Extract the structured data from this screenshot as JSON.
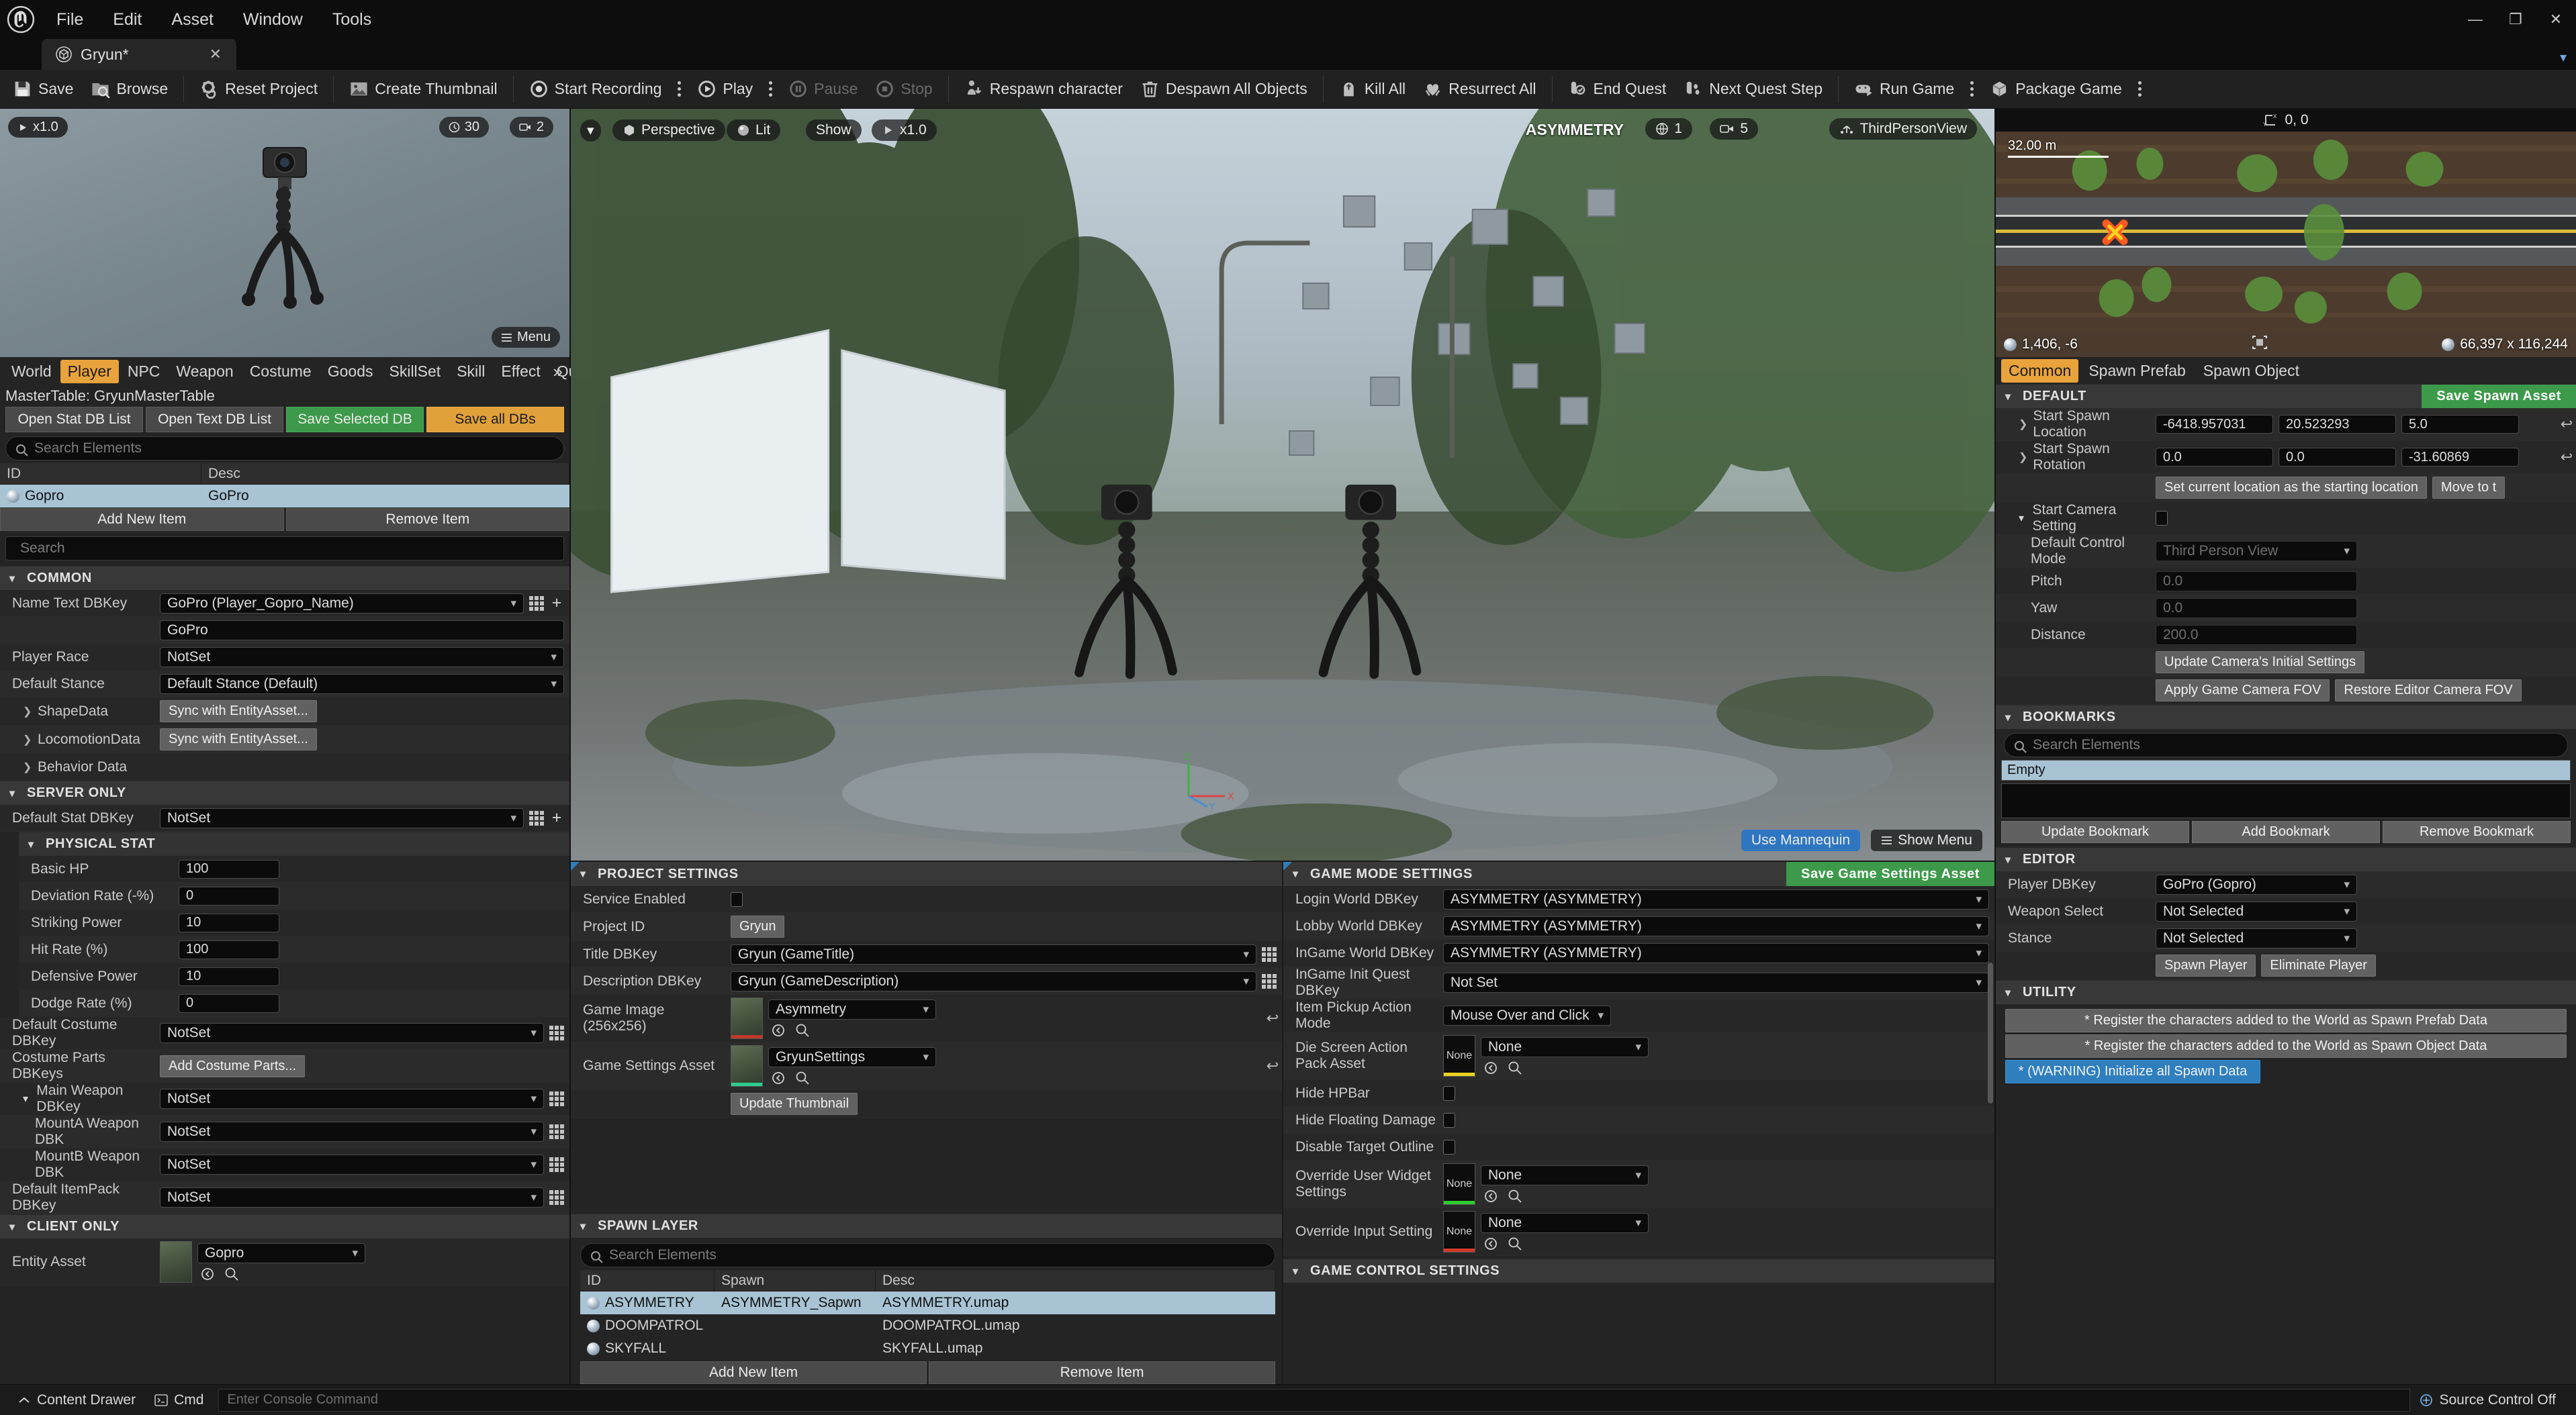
{
  "titlebar": {
    "menus": [
      "File",
      "Edit",
      "Asset",
      "Window",
      "Tools"
    ],
    "window_controls": {
      "minimize": "—",
      "maximize": "❐",
      "close": "✕"
    }
  },
  "tabstrip": {
    "tab_label": "Gryun*",
    "tab_close": "✕"
  },
  "toolbar": {
    "groups": [
      {
        "items": [
          {
            "name": "save-button",
            "label": "Save",
            "icon": "save-icon"
          },
          {
            "name": "browse-button",
            "label": "Browse",
            "icon": "browse-icon"
          }
        ]
      },
      {
        "items": [
          {
            "name": "reset-project-button",
            "label": "Reset Project",
            "icon": "gear-reset-icon"
          }
        ]
      },
      {
        "items": [
          {
            "name": "create-thumbnail-button",
            "label": "Create Thumbnail",
            "icon": "image-icon"
          }
        ]
      },
      {
        "items": [
          {
            "name": "start-recording-button",
            "label": "Start Recording",
            "icon": "record-icon",
            "kebab": true
          },
          {
            "name": "play-button",
            "label": "Play",
            "icon": "play-icon",
            "kebab": true
          },
          {
            "name": "pause-button",
            "label": "Pause",
            "icon": "pause-icon",
            "dim": true
          },
          {
            "name": "stop-button",
            "label": "Stop",
            "icon": "stop-icon",
            "dim": true
          }
        ]
      },
      {
        "items": [
          {
            "name": "respawn-character-button",
            "label": "Respawn character",
            "icon": "person-down-icon"
          },
          {
            "name": "despawn-all-objects-button",
            "label": "Despawn All Objects",
            "icon": "trash-icon"
          }
        ]
      },
      {
        "items": [
          {
            "name": "kill-all-button",
            "label": "Kill All",
            "icon": "tombstone-icon"
          },
          {
            "name": "resurrect-all-button",
            "label": "Resurrect All",
            "icon": "wings-icon"
          }
        ]
      },
      {
        "items": [
          {
            "name": "end-quest-button",
            "label": "End Quest",
            "icon": "scroll-check-icon"
          },
          {
            "name": "next-quest-step-button",
            "label": "Next Quest Step",
            "icon": "scroll-steps-icon"
          }
        ]
      },
      {
        "items": [
          {
            "name": "run-game-button",
            "label": "Run Game",
            "icon": "gamepad-icon",
            "kebab": true
          },
          {
            "name": "package-game-button",
            "label": "Package Game",
            "icon": "box-icon",
            "kebab": true
          }
        ]
      }
    ]
  },
  "preview": {
    "scale_badge": "x1.0",
    "fps_badge": "30",
    "cam_badge": "2",
    "menu_badge": "Menu"
  },
  "db": {
    "tabs": [
      "World",
      "Player",
      "NPC",
      "Weapon",
      "Costume",
      "Goods",
      "SkillSet",
      "Skill",
      "Effect",
      "Quest"
    ],
    "active_tab": "Player",
    "mastertable_label": "MasterTable:",
    "mastertable_value": "GryunMasterTable",
    "buttons": [
      {
        "label": "Open Stat DB List",
        "style": "grey"
      },
      {
        "label": "Open Text DB List",
        "style": "grey"
      },
      {
        "label": "Save Selected DB",
        "style": "green"
      },
      {
        "label": "Save all DBs",
        "style": "orange"
      }
    ],
    "search_placeholder": "Search Elements",
    "columns": [
      "ID",
      "Desc"
    ],
    "rows": [
      {
        "id": "Gopro",
        "desc": "GoPro",
        "selected": true
      }
    ],
    "add_label": "Add New Item",
    "remove_label": "Remove Item"
  },
  "details": {
    "search_placeholder": "Search",
    "sections": [
      {
        "title": "COMMON",
        "rows": [
          {
            "label": "Name Text DBKey",
            "type": "combo",
            "value": "GoPro (Player_Gopro_Name)",
            "grid": true,
            "plus": true
          },
          {
            "label": "",
            "type": "text",
            "value": "GoPro"
          },
          {
            "label": "Player Race",
            "type": "combo",
            "value": "NotSet"
          },
          {
            "label": "Default Stance",
            "type": "combo",
            "value": "Default Stance (Default)"
          },
          {
            "label": "ShapeData",
            "type": "button",
            "value": "Sync with EntityAsset...",
            "expand": true
          },
          {
            "label": "LocomotionData",
            "type": "button",
            "value": "Sync with EntityAsset...",
            "expand": true
          },
          {
            "label": "Behavior Data",
            "type": "empty",
            "value": "",
            "expand": true
          }
        ]
      },
      {
        "title": "SERVER ONLY",
        "rows": [
          {
            "label": "Default Stat DBKey",
            "type": "combo",
            "value": "NotSet",
            "grid": true,
            "plus": true
          }
        ]
      },
      {
        "title": "PHYSICAL STAT",
        "sub": true,
        "rows": [
          {
            "label": "Basic HP",
            "type": "num",
            "value": "100"
          },
          {
            "label": "Deviation Rate (-%)",
            "type": "num",
            "value": "0"
          },
          {
            "label": "Striking Power",
            "type": "num",
            "value": "10"
          },
          {
            "label": "Hit Rate (%)",
            "type": "num",
            "value": "100"
          },
          {
            "label": "Defensive Power",
            "type": "num",
            "value": "10"
          },
          {
            "label": "Dodge Rate (%)",
            "type": "num",
            "value": "0"
          }
        ]
      },
      {
        "title": "",
        "rows": [
          {
            "label": "Default Costume DBKey",
            "type": "combo",
            "value": "NotSet",
            "grid": true
          },
          {
            "label": "Costume Parts DBKeys",
            "type": "button",
            "value": "Add Costume Parts..."
          },
          {
            "label": "Main Weapon DBKey",
            "type": "combo",
            "value": "NotSet",
            "grid": true,
            "expanded": true
          },
          {
            "label": "MountA Weapon DBK",
            "type": "combo",
            "value": "NotSet",
            "grid": true,
            "indent": 2
          },
          {
            "label": "MountB Weapon DBK",
            "type": "combo",
            "value": "NotSet",
            "grid": true,
            "indent": 2
          },
          {
            "label": "Default ItemPack DBKey",
            "type": "combo",
            "value": "NotSet",
            "grid": true
          }
        ]
      },
      {
        "title": "CLIENT ONLY",
        "rows": [
          {
            "label": "Entity Asset",
            "type": "asset",
            "value": "Gopro"
          }
        ]
      }
    ]
  },
  "viewport": {
    "perspective": "Perspective",
    "lighting": "Lit",
    "show": "Show",
    "speed": "x1.0",
    "world_name": "ASYMMETRY",
    "globe_count": "1",
    "camera_count": "5",
    "view_mode": "ThirdPersonView",
    "use_mannequin": "Use Mannequin",
    "show_menu": "Show Menu"
  },
  "project_settings": {
    "title": "PROJECT SETTINGS",
    "rows": [
      {
        "label": "Service Enabled",
        "type": "check",
        "value": ""
      },
      {
        "label": "Project ID",
        "type": "button",
        "value": "Gryun"
      },
      {
        "label": "Title DBKey",
        "type": "combo",
        "value": "Gryun (GameTitle)",
        "grid": true
      },
      {
        "label": "Description DBKey",
        "type": "combo",
        "value": "Gryun (GameDescription)",
        "grid": true
      },
      {
        "label": "Game Image (256x256)",
        "type": "asset",
        "value": "Asymmetry",
        "bar": "#c0392b",
        "revert": true
      },
      {
        "label": "Game Settings Asset",
        "type": "asset",
        "value": "GryunSettings",
        "bar": "#2ecc8f",
        "revert": true
      },
      {
        "label": "",
        "type": "button",
        "value": "Update Thumbnail"
      }
    ]
  },
  "spawn_layer": {
    "title": "SPAWN LAYER",
    "search_placeholder": "Search Elements",
    "columns": [
      "ID",
      "Spawn",
      "Desc"
    ],
    "rows": [
      {
        "id": "ASYMMETRY",
        "spawn": "ASYMMETRY_Sapwn",
        "desc": "ASYMMETRY.umap",
        "selected": true
      },
      {
        "id": "DOOMPATROL",
        "spawn": "",
        "desc": "DOOMPATROL.umap",
        "selected": false
      },
      {
        "id": "SKYFALL",
        "spawn": "",
        "desc": "SKYFALL.umap",
        "selected": false
      }
    ],
    "add_label": "Add New Item",
    "remove_label": "Remove Item"
  },
  "game_mode_settings": {
    "title": "GAME MODE SETTINGS",
    "save_button": "Save Game Settings Asset",
    "rows": [
      {
        "label": "Login World DBKey",
        "type": "combo",
        "value": "ASYMMETRY (ASYMMETRY)"
      },
      {
        "label": "Lobby World DBKey",
        "type": "combo",
        "value": "ASYMMETRY (ASYMMETRY)"
      },
      {
        "label": "InGame World DBKey",
        "type": "combo",
        "value": "ASYMMETRY (ASYMMETRY)"
      },
      {
        "label": "InGame Init Quest DBKey",
        "type": "combo",
        "value": "Not Set"
      },
      {
        "label": "Item Pickup Action Mode",
        "type": "combo-small",
        "value": "Mouse Over and Click"
      },
      {
        "label": "Die Screen Action Pack Asset",
        "type": "asset",
        "value": "None",
        "thumb_label": "None",
        "bar": "#e8d21f"
      },
      {
        "label": "Hide HPBar",
        "type": "check",
        "value": ""
      },
      {
        "label": "Hide Floating Damage",
        "type": "check",
        "value": ""
      },
      {
        "label": "Disable Target Outline",
        "type": "check",
        "value": ""
      },
      {
        "label": "Override User Widget Settings",
        "type": "asset",
        "value": "None",
        "thumb_label": "None",
        "bar": "#2ecc2e"
      },
      {
        "label": "Override Input Setting",
        "type": "asset",
        "value": "None",
        "thumb_label": "None",
        "bar": "#d13a2a"
      }
    ],
    "footer_section": "GAME CONTROL SETTINGS"
  },
  "minimap": {
    "coords_label": "0, 0",
    "scale": "32.00 m",
    "position": "1,406, -6",
    "dimensions": "66,397 x 116,244"
  },
  "right_panel": {
    "tabs": [
      "Common",
      "Spawn Prefab",
      "Spawn Object"
    ],
    "active_tab": "Common",
    "default_section": {
      "title": "DEFAULT",
      "save_button": "Save Spawn Asset",
      "spawn_location_label": "Start Spawn Location",
      "spawn_location": [
        "-6418.957031",
        "20.523293",
        "5.0"
      ],
      "spawn_rotation_label": "Start Spawn Rotation",
      "spawn_rotation": [
        "0.0",
        "0.0",
        "-31.60869"
      ],
      "set_location_button": "Set current location as the starting location",
      "move_to_button": "Move to t",
      "camera_setting_label": "Start Camera Setting",
      "control_mode_label": "Default Control Mode",
      "control_mode_value": "Third Person View",
      "pitch_label": "Pitch",
      "pitch_value": "0.0",
      "yaw_label": "Yaw",
      "yaw_value": "0.0",
      "distance_label": "Distance",
      "distance_value": "200.0",
      "update_camera_button": "Update Camera's Initial Settings",
      "apply_fov_button": "Apply Game Camera FOV",
      "restore_fov_button": "Restore Editor Camera FOV"
    },
    "bookmarks": {
      "title": "BOOKMARKS",
      "search_placeholder": "Search Elements",
      "selected_item": "Empty",
      "buttons": [
        "Update Bookmark",
        "Add Bookmark",
        "Remove Bookmark"
      ]
    },
    "editor": {
      "title": "EDITOR",
      "rows": [
        {
          "label": "Player DBKey",
          "value": "GoPro (Gopro)"
        },
        {
          "label": "Weapon Select",
          "value": "Not Selected"
        },
        {
          "label": "Stance",
          "value": "Not Selected"
        }
      ],
      "spawn_player_button": "Spawn Player",
      "eliminate_player_button": "Eliminate Player"
    },
    "utility": {
      "title": "UTILITY",
      "buttons": [
        {
          "label": "* Register the characters added to the World as Spawn Prefab Data",
          "style": "grey"
        },
        {
          "label": "* Register the characters added to the World as Spawn Object Data",
          "style": "grey"
        },
        {
          "label": "* (WARNING) Initialize all Spawn Data",
          "style": "blue"
        }
      ]
    }
  },
  "statusbar": {
    "content_drawer": "Content Drawer",
    "cmd_label": "Cmd",
    "cmd_placeholder": "Enter Console Command",
    "source_control": "Source Control Off"
  }
}
